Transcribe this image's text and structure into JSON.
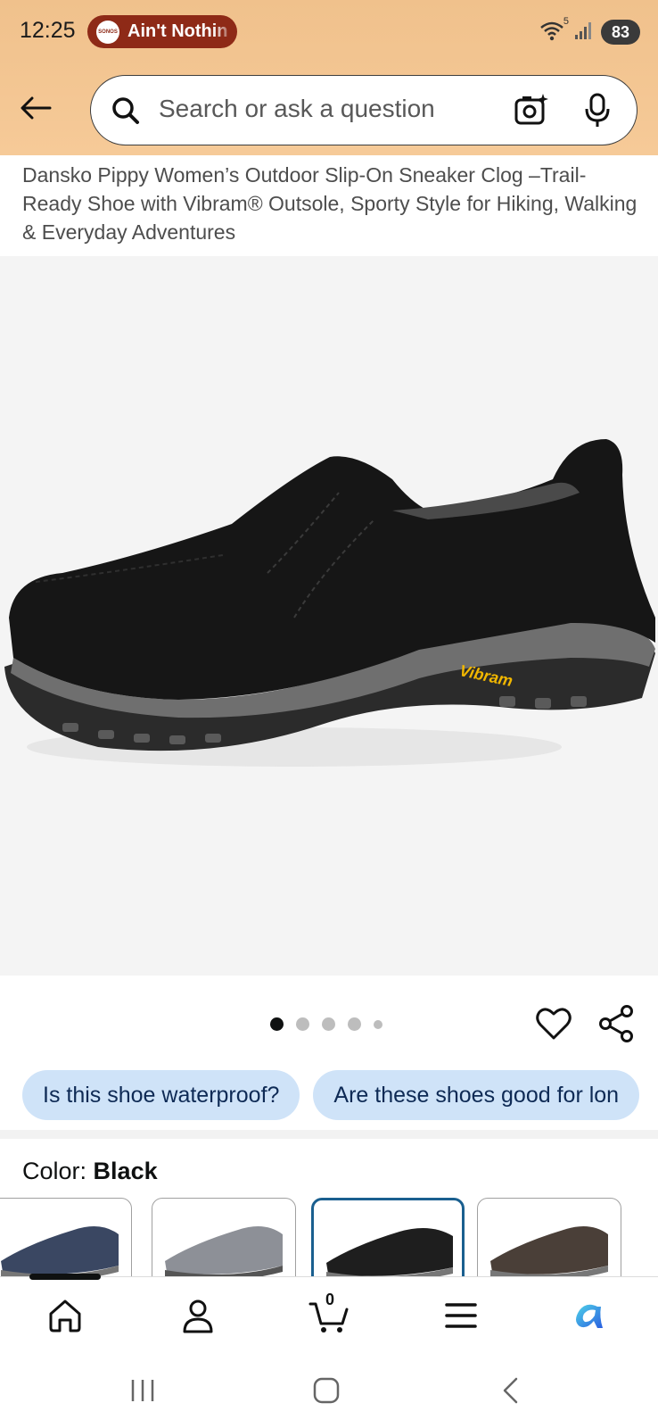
{
  "status_bar": {
    "time": "12:25",
    "media_app": "SONOS",
    "media_title": "Ain't Nothin",
    "wifi_badge": "5",
    "battery": "83"
  },
  "search": {
    "placeholder": "Search or ask a question"
  },
  "product": {
    "title": "Dansko Pippy Women’s Outdoor Slip-On Sneaker Clog –Trail-Ready Shoe with Vibram® Outsole, Sporty Style for Hiking, Walking & Everyday Adventures",
    "image_alt": "Black suede slip-on shoe with grey Vibram sole",
    "sole_brand": "Vibram",
    "image_count": 5,
    "active_image": 1
  },
  "questions": [
    "Is this shoe waterproof?",
    "Are these shoes good for lon"
  ],
  "color": {
    "label": "Color:",
    "value": "Black",
    "swatches": [
      {
        "name": "Navy",
        "color": "#3a4762",
        "selected": false
      },
      {
        "name": "Grey",
        "color": "#8d9097",
        "selected": false
      },
      {
        "name": "Black",
        "color": "#1e1e1e",
        "selected": true
      },
      {
        "name": "Brown",
        "color": "#4a3f38",
        "selected": false
      }
    ]
  },
  "bottom_nav": {
    "cart_count": "0",
    "items": [
      "home-icon",
      "account-icon",
      "cart-icon",
      "menu-icon",
      "rufus-icon"
    ]
  },
  "colors": {
    "header_bg": "#f3c591",
    "chip_bg": "#cfe3f8",
    "chip_text": "#0e2a55",
    "selected_border": "#1a5f8f",
    "media_pill": "#8e2a17"
  }
}
